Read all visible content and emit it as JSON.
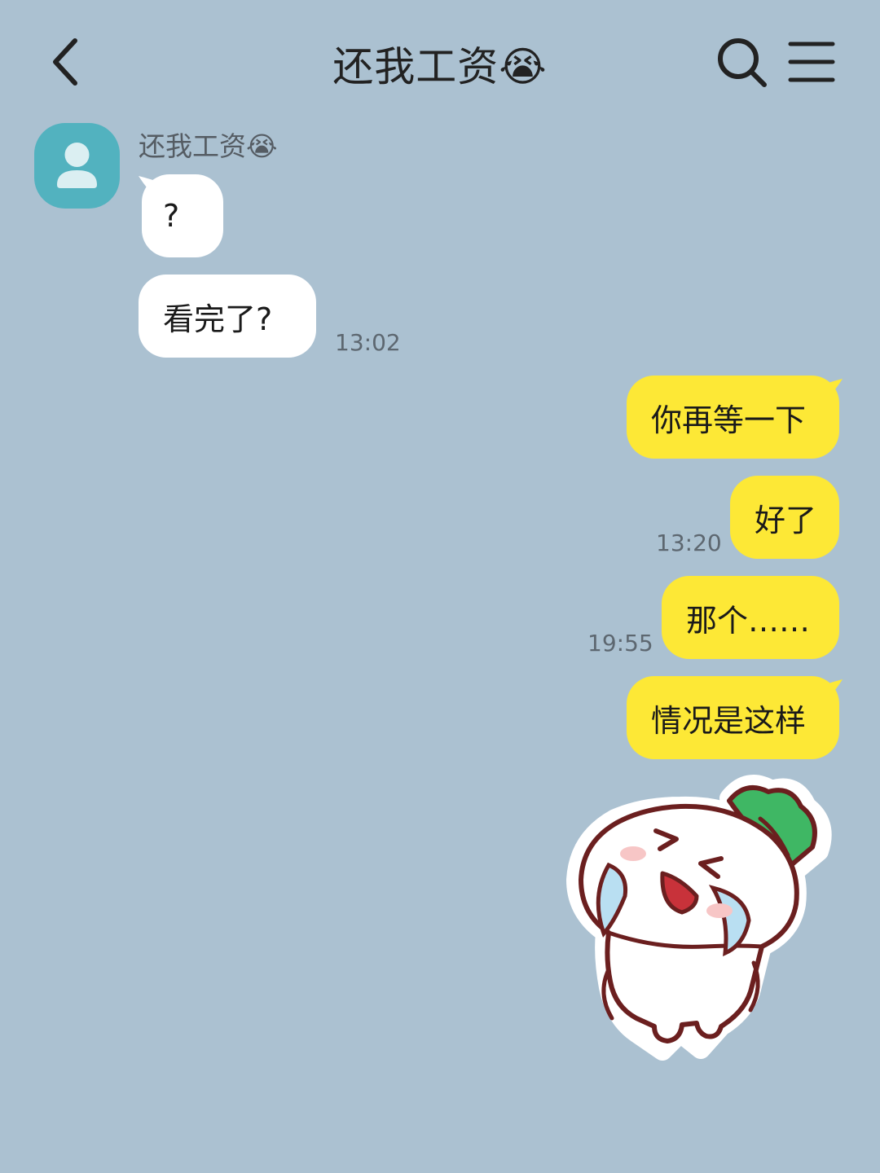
{
  "header": {
    "title": "还我工资😭",
    "back_icon": "chevron-left-icon",
    "search_icon": "search-icon",
    "menu_icon": "hamburger-menu-icon"
  },
  "chat": {
    "sender_name": "还我工资😭",
    "avatar_icon": "person-icon",
    "messages": [
      {
        "direction": "in",
        "text": "?"
      },
      {
        "direction": "in",
        "text": "看完了?",
        "time": "13:02"
      },
      {
        "direction": "out",
        "text": "你再等一下"
      },
      {
        "direction": "out",
        "text": "好了",
        "time": "13:20"
      },
      {
        "direction": "out",
        "text": "那个……",
        "time": "19:55"
      },
      {
        "direction": "out",
        "text": "情况是这样"
      }
    ],
    "sticker": "crying-radish-sticker"
  },
  "colors": {
    "background": "#abc1d1",
    "incoming_bubble": "#ffffff",
    "outgoing_bubble": "#fde836",
    "avatar": "#52b2bf"
  }
}
